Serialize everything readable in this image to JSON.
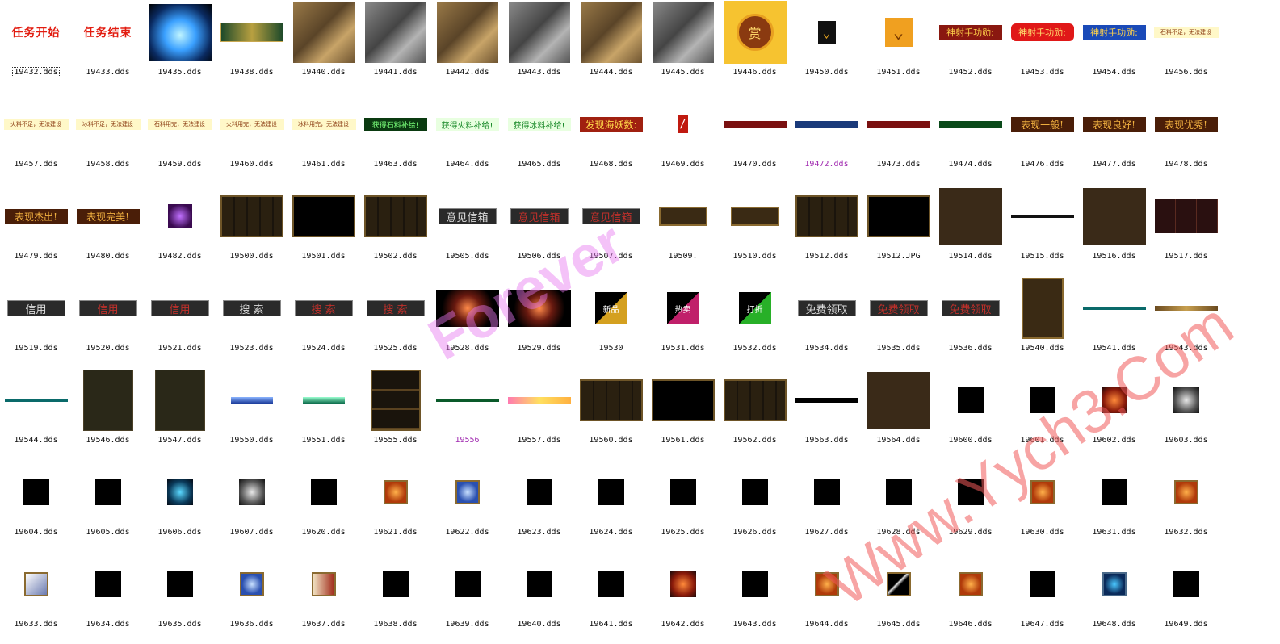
{
  "watermarks": [
    "Forever",
    "Www.Yych3.Com"
  ],
  "files": [
    {
      "name": "19432.dds",
      "thumb": "banner-red",
      "text": "任务开始",
      "selected": true
    },
    {
      "name": "19433.dds",
      "thumb": "banner-red",
      "text": "任务结束"
    },
    {
      "name": "19435.dds",
      "thumb": "crystal-icon"
    },
    {
      "name": "19438.dds",
      "thumb": "strip-gold"
    },
    {
      "name": "19440.dds",
      "thumb": "map-scene"
    },
    {
      "name": "19441.dds",
      "thumb": "map-scene-gray"
    },
    {
      "name": "19442.dds",
      "thumb": "map-scene"
    },
    {
      "name": "19443.dds",
      "thumb": "map-scene-gray"
    },
    {
      "name": "19444.dds",
      "thumb": "map-scene"
    },
    {
      "name": "19445.dds",
      "thumb": "map-scene-gray"
    },
    {
      "name": "19446.dds",
      "thumb": "reward-badge",
      "text": "赏"
    },
    {
      "name": "19450.dds",
      "thumb": "chevron-down-icon"
    },
    {
      "name": "19451.dds",
      "thumb": "chevron-down-icon-large"
    },
    {
      "name": "19452.dds",
      "thumb": "title-plate",
      "text": "神射手功勋:"
    },
    {
      "name": "19453.dds",
      "thumb": "title-plate-red",
      "text": "神射手功勋:"
    },
    {
      "name": "19454.dds",
      "thumb": "title-plate-blue",
      "text": "神射手功勋:"
    },
    {
      "name": "19456.dds",
      "thumb": "note-strip",
      "text": "石料不足，无法建设"
    },
    {
      "name": "19457.dds",
      "thumb": "note-strip",
      "text": "火料不足，无法建设"
    },
    {
      "name": "19458.dds",
      "thumb": "note-strip",
      "text": "冰料不足，无法建设"
    },
    {
      "name": "19459.dds",
      "thumb": "note-strip",
      "text": "石料用完，无法建设"
    },
    {
      "name": "19460.dds",
      "thumb": "note-strip",
      "text": "火料用完，无法建设"
    },
    {
      "name": "19461.dds",
      "thumb": "note-strip",
      "text": "冰料用完，无法建设"
    },
    {
      "name": "19463.dds",
      "thumb": "green-strip",
      "text": "获得石料补给!"
    },
    {
      "name": "19464.dds",
      "thumb": "green-strip-light",
      "text": "获得火料补给!"
    },
    {
      "name": "19465.dds",
      "thumb": "green-strip-light",
      "text": "获得冰料补给!"
    },
    {
      "name": "19468.dds",
      "thumb": "yellow-plate",
      "text": "发现海妖数:"
    },
    {
      "name": "19469.dds",
      "thumb": "slash-icon"
    },
    {
      "name": "19470.dds",
      "thumb": "thin-bar-red"
    },
    {
      "name": "19472.dds",
      "thumb": "thin-bar-blue",
      "purple": true
    },
    {
      "name": "19473.dds",
      "thumb": "thin-bar-red"
    },
    {
      "name": "19474.dds",
      "thumb": "thin-bar-green"
    },
    {
      "name": "19476.dds",
      "thumb": "rating-plate",
      "text": "表现一般!"
    },
    {
      "name": "19477.dds",
      "thumb": "rating-plate",
      "text": "表现良好!"
    },
    {
      "name": "19478.dds",
      "thumb": "rating-plate",
      "text": "表现优秀!"
    },
    {
      "name": "19479.dds",
      "thumb": "rating-plate",
      "text": "表现杰出!"
    },
    {
      "name": "19480.dds",
      "thumb": "rating-plate",
      "text": "表现完美!"
    },
    {
      "name": "19482.dds",
      "thumb": "creature-icon"
    },
    {
      "name": "19500.dds",
      "thumb": "frame-panel"
    },
    {
      "name": "19501.dds",
      "thumb": "frame-panel-dark"
    },
    {
      "name": "19502.dds",
      "thumb": "frame-panel"
    },
    {
      "name": "19505.dds",
      "thumb": "button",
      "text": "意见信箱"
    },
    {
      "name": "19506.dds",
      "thumb": "button-red",
      "text": "意见信箱"
    },
    {
      "name": "19507.dds",
      "thumb": "button-red",
      "text": "意见信箱"
    },
    {
      "name": "19509.",
      "thumb": "wood-bar"
    },
    {
      "name": "19510.dds",
      "thumb": "wood-bar"
    },
    {
      "name": "19512.dds",
      "thumb": "frame-panel"
    },
    {
      "name": "19512.JPG",
      "thumb": "frame-panel-dark"
    },
    {
      "name": "19514.dds",
      "thumb": "brown-square"
    },
    {
      "name": "19515.dds",
      "thumb": "hairline"
    },
    {
      "name": "19516.dds",
      "thumb": "brown-square"
    },
    {
      "name": "19517.dds",
      "thumb": "grid-panel"
    },
    {
      "name": "19519.dds",
      "thumb": "button",
      "text": "信用"
    },
    {
      "name": "19520.dds",
      "thumb": "button-red",
      "text": "信用"
    },
    {
      "name": "19521.dds",
      "thumb": "button-red",
      "text": "信用"
    },
    {
      "name": "19523.dds",
      "thumb": "button",
      "text": "搜 索"
    },
    {
      "name": "19524.dds",
      "thumb": "button-red",
      "text": "搜 索"
    },
    {
      "name": "19525.dds",
      "thumb": "button-red",
      "text": "搜 索"
    },
    {
      "name": "19528.dds",
      "thumb": "sparkle-effect"
    },
    {
      "name": "19529.dds",
      "thumb": "sparkle-effect"
    },
    {
      "name": "19530",
      "thumb": "corner-tag",
      "text": "新品",
      "color": "#d4a020"
    },
    {
      "name": "19531.dds",
      "thumb": "corner-tag",
      "text": "热卖",
      "color": "#c0206a"
    },
    {
      "name": "19532.dds",
      "thumb": "corner-tag",
      "text": "打折",
      "color": "#28b028"
    },
    {
      "name": "19534.dds",
      "thumb": "button",
      "text": "免费领取"
    },
    {
      "name": "19535.dds",
      "thumb": "button-red",
      "text": "免费领取"
    },
    {
      "name": "19536.dds",
      "thumb": "button-red",
      "text": "免费领取"
    },
    {
      "name": "19540.dds",
      "thumb": "tall-panel"
    },
    {
      "name": "19541.dds",
      "thumb": "hairline-teal"
    },
    {
      "name": "19543.dds",
      "thumb": "thin-gold-bar"
    },
    {
      "name": "19544.dds",
      "thumb": "hairline-teal"
    },
    {
      "name": "19546.dds",
      "thumb": "tall-dark-panel"
    },
    {
      "name": "19547.dds",
      "thumb": "tall-dark-panel"
    },
    {
      "name": "19550.dds",
      "thumb": "blue-bar"
    },
    {
      "name": "19551.dds",
      "thumb": "teal-bar"
    },
    {
      "name": "19555.dds",
      "thumb": "list-panel"
    },
    {
      "name": "19556",
      "thumb": "hairline-green",
      "purple": true
    },
    {
      "name": "19557.dds",
      "thumb": "yellow-gradient-bar"
    },
    {
      "name": "19560.dds",
      "thumb": "frame-panel"
    },
    {
      "name": "19561.dds",
      "thumb": "frame-panel-dark"
    },
    {
      "name": "19562.dds",
      "thumb": "frame-panel"
    },
    {
      "name": "19563.dds",
      "thumb": "black-bar"
    },
    {
      "name": "19564.dds",
      "thumb": "brown-square"
    },
    {
      "name": "19600.dds",
      "thumb": "black-square"
    },
    {
      "name": "19601.dds",
      "thumb": "black-square"
    },
    {
      "name": "19602.dds",
      "thumb": "fire-skill-icon"
    },
    {
      "name": "19603.dds",
      "thumb": "smoke-skill-icon"
    },
    {
      "name": "19604.dds",
      "thumb": "black-square"
    },
    {
      "name": "19605.dds",
      "thumb": "black-square"
    },
    {
      "name": "19606.dds",
      "thumb": "water-skill-icon"
    },
    {
      "name": "19607.dds",
      "thumb": "smoke-skill-icon"
    },
    {
      "name": "19620.dds",
      "thumb": "black-square"
    },
    {
      "name": "19621.dds",
      "thumb": "fire-skill-icon-framed"
    },
    {
      "name": "19622.dds",
      "thumb": "ice-skill-icon-framed"
    },
    {
      "name": "19623.dds",
      "thumb": "black-square"
    },
    {
      "name": "19624.dds",
      "thumb": "black-square"
    },
    {
      "name": "19625.dds",
      "thumb": "black-square"
    },
    {
      "name": "19626.dds",
      "thumb": "black-square"
    },
    {
      "name": "19627.dds",
      "thumb": "black-square"
    },
    {
      "name": "19628.dds",
      "thumb": "black-square"
    },
    {
      "name": "19629.dds",
      "thumb": "black-square"
    },
    {
      "name": "19630.dds",
      "thumb": "fire-skill-icon-framed"
    },
    {
      "name": "19631.dds",
      "thumb": "black-square"
    },
    {
      "name": "19632.dds",
      "thumb": "fire-skill-icon-framed"
    },
    {
      "name": "19633.dds",
      "thumb": "lightning-skill-icon-framed"
    },
    {
      "name": "19634.dds",
      "thumb": "black-square"
    },
    {
      "name": "19635.dds",
      "thumb": "black-square"
    },
    {
      "name": "19636.dds",
      "thumb": "ice-skill-icon-framed"
    },
    {
      "name": "19637.dds",
      "thumb": "scroll-skill-icon-framed"
    },
    {
      "name": "19638.dds",
      "thumb": "black-square"
    },
    {
      "name": "19639.dds",
      "thumb": "black-square"
    },
    {
      "name": "19640.dds",
      "thumb": "black-square"
    },
    {
      "name": "19641.dds",
      "thumb": "black-square"
    },
    {
      "name": "19642.dds",
      "thumb": "fire-skill-icon"
    },
    {
      "name": "19643.dds",
      "thumb": "black-square"
    },
    {
      "name": "19644.dds",
      "thumb": "fire-skill-icon-framed"
    },
    {
      "name": "19645.dds",
      "thumb": "slash-skill-icon-framed"
    },
    {
      "name": "19646.dds",
      "thumb": "fire-skill-icon-framed"
    },
    {
      "name": "19647.dds",
      "thumb": "black-square"
    },
    {
      "name": "19648.dds",
      "thumb": "water-skill-icon-framed"
    },
    {
      "name": "19649.dds",
      "thumb": "black-square"
    }
  ]
}
